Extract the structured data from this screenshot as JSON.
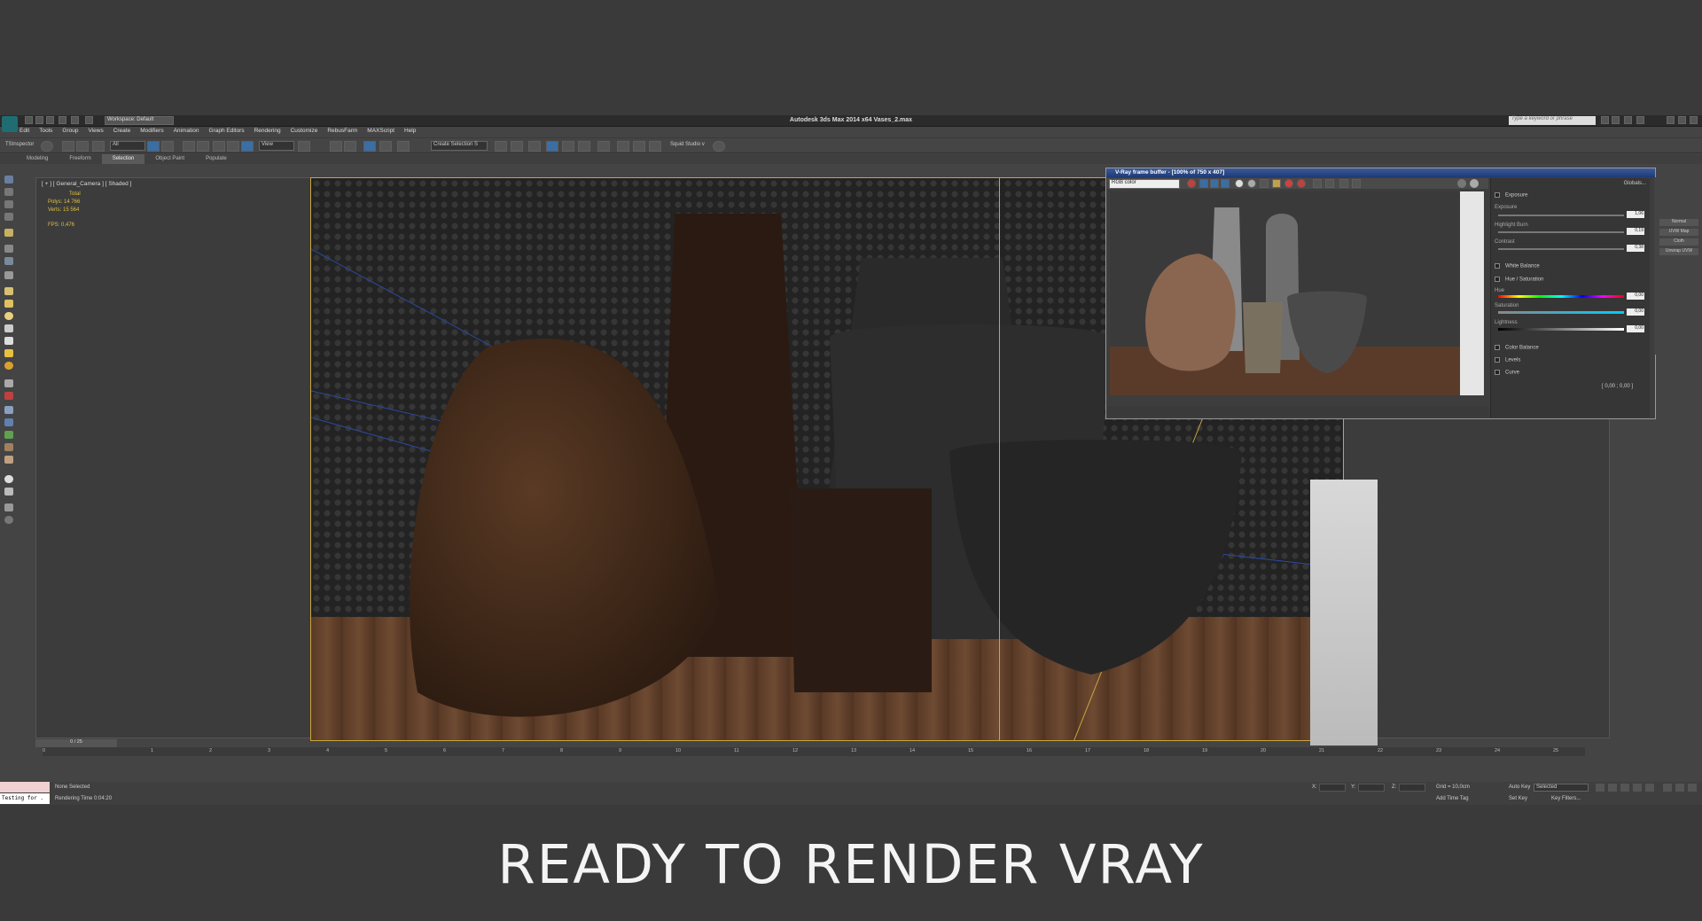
{
  "window": {
    "title": "Autodesk 3ds Max  2014 x64     Vases_2.max",
    "workspace": "Workspace: Default",
    "search_placeholder": "Type a keyword or phrase"
  },
  "menu": [
    "Edit",
    "Tools",
    "Group",
    "Views",
    "Create",
    "Modifiers",
    "Animation",
    "Graph Editors",
    "Rendering",
    "Customize",
    "RebusFarm",
    "MAXScript",
    "Help"
  ],
  "toolbar": {
    "tsinspector": "TSInspector",
    "filter": "All",
    "view": "View",
    "selection_set": "Create Selection S",
    "squid_studio": "Squid Studio v"
  },
  "ribbon_tabs": [
    "Modeling",
    "Freeform",
    "Selection",
    "Object Paint",
    "Populate"
  ],
  "ribbon_active": "Selection",
  "viewport": {
    "label": "[ + ] [ General_Camera ] [ Shaded ]",
    "stats_total": "Total",
    "stats_polys": "Polys:    14 766",
    "stats_verts": "Verts:    15 564",
    "stats_fps": "FPS:     0,476"
  },
  "vfb": {
    "title": "V-Ray frame buffer - [100% of 750 x 407]",
    "channel": "RGB color",
    "globals": "Globals...",
    "sections": {
      "exposure": "Exposure",
      "exposure_label": "Exposure",
      "exposure_value": "1,06",
      "highlight_label": "Highlight Burn",
      "highlight_value": "0,19",
      "contrast_label": "Contrast",
      "contrast_value": "0,38",
      "white_balance": "White Balance",
      "hue_saturation": "Hue / Saturation",
      "hue_label": "Hue",
      "hue_value": "0,00",
      "saturation_label": "Saturation",
      "saturation_value": "0,00",
      "lightness_label": "Lightness",
      "lightness_value": "0,00",
      "color_balance": "Color Balance",
      "levels": "Levels",
      "curve": "Curve",
      "curve_readout": "[ 0,00 ; 0,00 ]"
    }
  },
  "right_panel": [
    "Normal",
    "UVW Map",
    "Cloth",
    "Unwrap UVW"
  ],
  "timeline": {
    "slider": "0 / 25",
    "ticks": [
      "0",
      "1",
      "2",
      "3",
      "4",
      "5",
      "6",
      "7",
      "8",
      "9",
      "10",
      "11",
      "12",
      "13",
      "14",
      "15",
      "16",
      "17",
      "18",
      "19",
      "20",
      "21",
      "22",
      "23",
      "24",
      "25"
    ]
  },
  "status": {
    "selection": "None Selected",
    "render_time": "Rendering Time  0:04:20",
    "testing": "Testing for .",
    "x_label": "X:",
    "y_label": "Y:",
    "z_label": "Z:",
    "grid": "Grid = 10,0cm",
    "add_time_tag": "Add Time Tag",
    "auto_key": "Auto Key",
    "auto_key_mode": "Selected",
    "set_key": "Set Key",
    "key_filters": "Key Filters..."
  },
  "caption": "READY TO RENDER  VRAY"
}
